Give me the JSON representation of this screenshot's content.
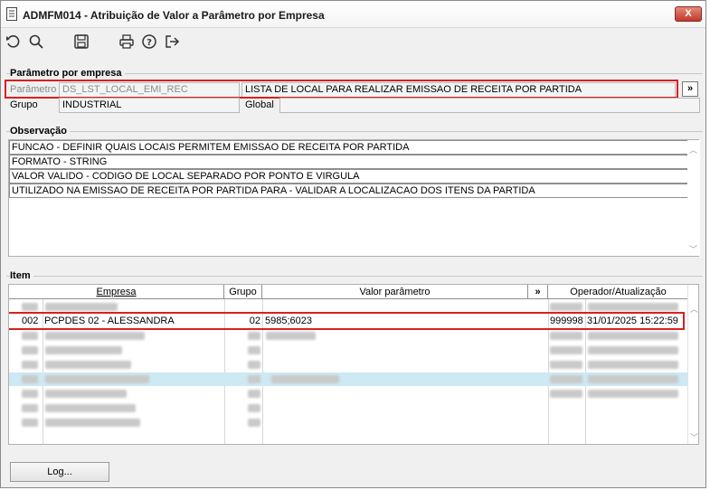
{
  "window": {
    "title": "ADMFM014 - Atribuição de Valor a Parâmetro por Empresa",
    "close_label": "X"
  },
  "toolbar": {
    "icons": [
      "undo-icon",
      "search-icon",
      "save-icon",
      "print-icon",
      "help-icon",
      "exit-icon"
    ]
  },
  "parametro_section": {
    "title": "Parâmetro por empresa",
    "parametro_label": "Parâmetro",
    "parametro_code": "DS_LST_LOCAL_EMI_REC",
    "parametro_desc": "LISTA DE LOCAL PARA REALIZAR EMISSAO DE RECEITA POR PARTIDA",
    "expand_label": "»",
    "grupo_label": "Grupo",
    "grupo_value": "INDUSTRIAL",
    "global_label": "Global",
    "global_value": ""
  },
  "observacao_section": {
    "title": "Observação",
    "lines": [
      "FUNCAO - DEFINIR QUAIS LOCAIS PERMITEM EMISSAO DE RECEITA POR PARTIDA",
      "FORMATO - STRING",
      "VALOR VALIDO - CODIGO DE LOCAL SEPARADO POR PONTO E VIRGULA",
      "UTILIZADO NA EMISSAO DE RECEITA POR PARTIDA PARA - VALIDAR A LOCALIZACAO DOS ITENS DA PARTIDA"
    ]
  },
  "item_section": {
    "title": "Item",
    "columns": {
      "empresa": "Empresa",
      "grupo": "Grupo",
      "valor": "Valor parâmetro",
      "expand": "»",
      "operador": "Operador/Atualização"
    },
    "highlighted_row": {
      "codigo": "002",
      "empresa": "PCPDES 02 - ALESSANDRA",
      "grupo": "02",
      "valor": "5985;6023",
      "operador": "999998",
      "atualizacao": "31/01/2025 15:22:59"
    }
  },
  "footer": {
    "log_label": "Log..."
  },
  "colors": {
    "highlight_frame": "#d92020",
    "selected_row": "#cde9f3"
  }
}
